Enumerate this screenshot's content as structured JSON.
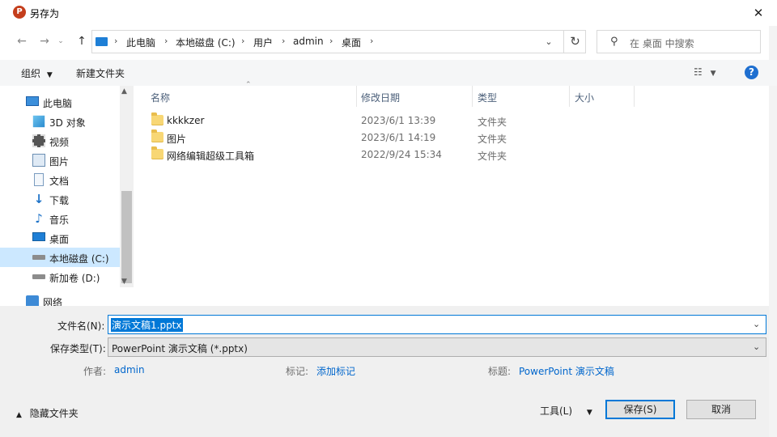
{
  "window": {
    "title": "另存为"
  },
  "address": {
    "crumbs": [
      "此电脑",
      "本地磁盘 (C:)",
      "用户",
      "admin",
      "桌面"
    ],
    "search_placeholder": "在 桌面 中搜索"
  },
  "toolbar": {
    "organize": "组织",
    "new_folder": "新建文件夹"
  },
  "nav_pane": {
    "items": [
      {
        "label": "此电脑",
        "icon": "computer-icon"
      },
      {
        "label": "3D 对象",
        "icon": "3d-objects-icon"
      },
      {
        "label": "视频",
        "icon": "video-icon"
      },
      {
        "label": "图片",
        "icon": "pictures-icon"
      },
      {
        "label": "文档",
        "icon": "documents-icon"
      },
      {
        "label": "下载",
        "icon": "download-icon"
      },
      {
        "label": "音乐",
        "icon": "music-icon"
      },
      {
        "label": "桌面",
        "icon": "desktop-icon"
      },
      {
        "label": "本地磁盘 (C:)",
        "icon": "drive-icon"
      },
      {
        "label": "新加卷 (D:)",
        "icon": "drive-icon"
      },
      {
        "label": "网络",
        "icon": "network-icon"
      }
    ]
  },
  "columns": {
    "name": "名称",
    "modified": "修改日期",
    "type": "类型",
    "size": "大小"
  },
  "files": [
    {
      "name": "kkkkzer",
      "modified": "2023/6/1 13:39",
      "type": "文件夹"
    },
    {
      "name": "图片",
      "modified": "2023/6/1 14:19",
      "type": "文件夹"
    },
    {
      "name": "网络编辑超级工具箱",
      "modified": "2022/9/24 15:34",
      "type": "文件夹"
    }
  ],
  "form": {
    "filename_label": "文件名(N):",
    "filename_value": "演示文稿1.pptx",
    "filetype_label": "保存类型(T):",
    "filetype_value": "PowerPoint 演示文稿 (*.pptx)",
    "author_label": "作者:",
    "author_value": "admin",
    "tags_label": "标记:",
    "tags_value": "添加标记",
    "title_label": "标题:",
    "title_value": "PowerPoint 演示文稿"
  },
  "footer": {
    "hide_folders": "隐藏文件夹",
    "tools": "工具(L)",
    "save": "保存(S)",
    "cancel": "取消"
  },
  "colors": {
    "accent": "#0078d7",
    "folder": "#f8d775",
    "link": "#0066cc",
    "selection": "#cce8ff"
  }
}
